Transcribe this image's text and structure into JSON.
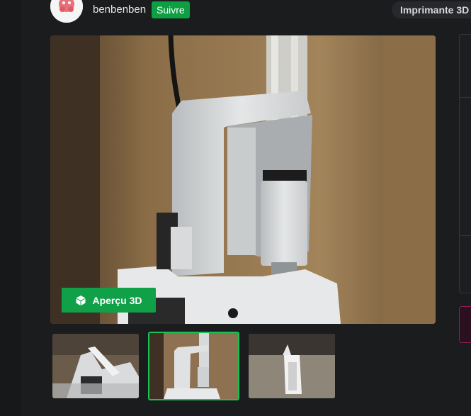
{
  "author": {
    "username": "benbenben",
    "follow_label": "Suivre"
  },
  "category": {
    "label": "Imprimante 3D"
  },
  "gallery": {
    "preview_label": "Aperçu 3D",
    "selected_index": 1,
    "thumbnail_count": 3
  },
  "colors": {
    "accent_green": "#10a048",
    "background": "#1b1c1e"
  },
  "icons": {
    "preview": "cube-icon"
  }
}
